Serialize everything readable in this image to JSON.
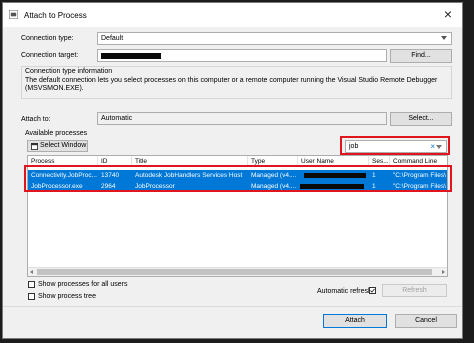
{
  "window": {
    "title": "Attach to Process"
  },
  "connection": {
    "type_label": "Connection type:",
    "type_value": "Default",
    "target_label": "Connection target:",
    "find_label": "Find...",
    "info_heading": "Connection type information",
    "info_text": "The default connection lets you select processes on this computer or a remote computer running the Visual Studio Remote Debugger (MSVSMON.EXE)."
  },
  "attach_to": {
    "label": "Attach to:",
    "value": "Automatic",
    "select_label": "Select..."
  },
  "processes": {
    "label": "Available processes",
    "select_window_label": "Select Window",
    "filter_value": "job",
    "clear_glyph": "×",
    "columns": [
      "Process",
      "ID",
      "Title",
      "Type",
      "User Name",
      "Ses...",
      "Command Line"
    ],
    "rows": [
      {
        "process": "Connectivity.JobProc...",
        "id": "13740",
        "title": "Autodesk JobHandlers Services Host",
        "type": "Managed (v4....",
        "user": "",
        "session": "1",
        "command": "\"C:\\Program Files\\"
      },
      {
        "process": "JobProcessor.exe",
        "id": "2964",
        "title": "JobProcessor",
        "type": "Managed (v4....",
        "user": "",
        "session": "1",
        "command": "\"C:\\Program Files\\"
      }
    ]
  },
  "options": {
    "show_all_users": "Show processes for all users",
    "show_tree": "Show process tree",
    "auto_refresh": "Automatic refresh",
    "auto_refresh_checked": true,
    "refresh_label": "Refresh"
  },
  "footer": {
    "attach_label": "Attach",
    "cancel_label": "Cancel"
  },
  "colors": {
    "selection": "#0078d7",
    "highlight_box": "#e0151e",
    "accent": "#0078d7"
  }
}
